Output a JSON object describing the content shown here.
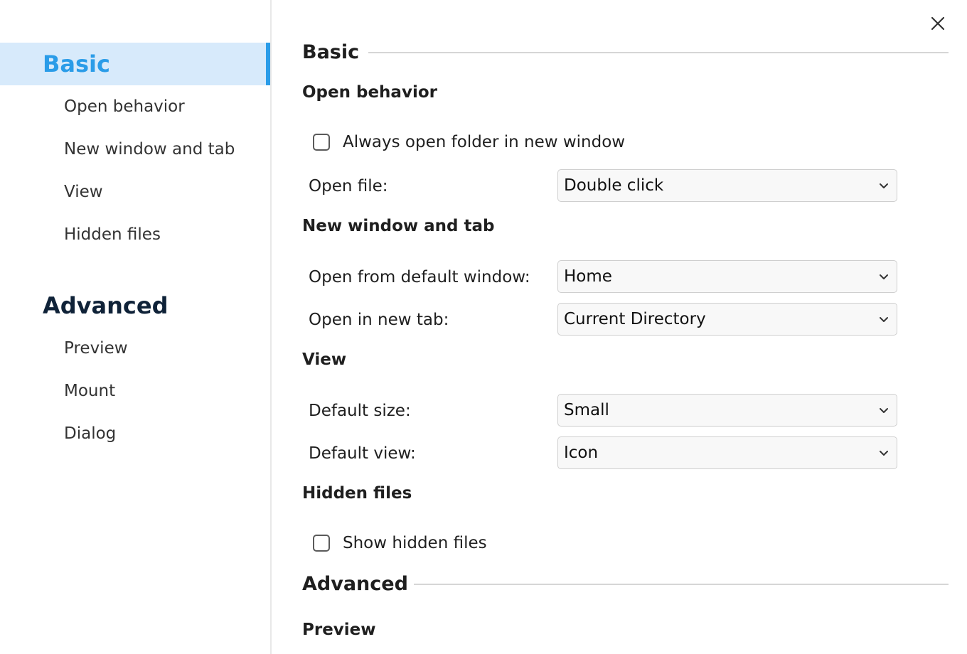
{
  "sidebar": {
    "groups": [
      {
        "label": "Basic",
        "items": [
          "Open behavior",
          "New window and tab",
          "View",
          "Hidden files"
        ]
      },
      {
        "label": "Advanced",
        "items": [
          "Preview",
          "Mount",
          "Dialog"
        ]
      }
    ]
  },
  "content": {
    "basic": {
      "title": "Basic",
      "open_behavior": {
        "title": "Open behavior",
        "always_open_label": "Always open folder in new window",
        "always_open_checked": false,
        "open_file_label": "Open file:",
        "open_file_value": "Double click"
      },
      "new_window_tab": {
        "title": "New window and tab",
        "default_window_label": "Open from default window:",
        "default_window_value": "Home",
        "new_tab_label": "Open in new tab:",
        "new_tab_value": "Current Directory"
      },
      "view": {
        "title": "View",
        "default_size_label": "Default size:",
        "default_size_value": "Small",
        "default_view_label": "Default view:",
        "default_view_value": "Icon"
      },
      "hidden_files": {
        "title": "Hidden files",
        "show_hidden_label": "Show hidden files",
        "show_hidden_checked": false
      }
    },
    "advanced": {
      "title": "Advanced",
      "preview_title": "Preview"
    }
  },
  "icons": {
    "close": "close-icon",
    "dropdown": "chevron-down-icon",
    "checkbox": "checkbox-unchecked"
  },
  "colors": {
    "accent": "#2a9ce8",
    "active_bg": "#d7eafb",
    "heading": "#0f2238"
  }
}
